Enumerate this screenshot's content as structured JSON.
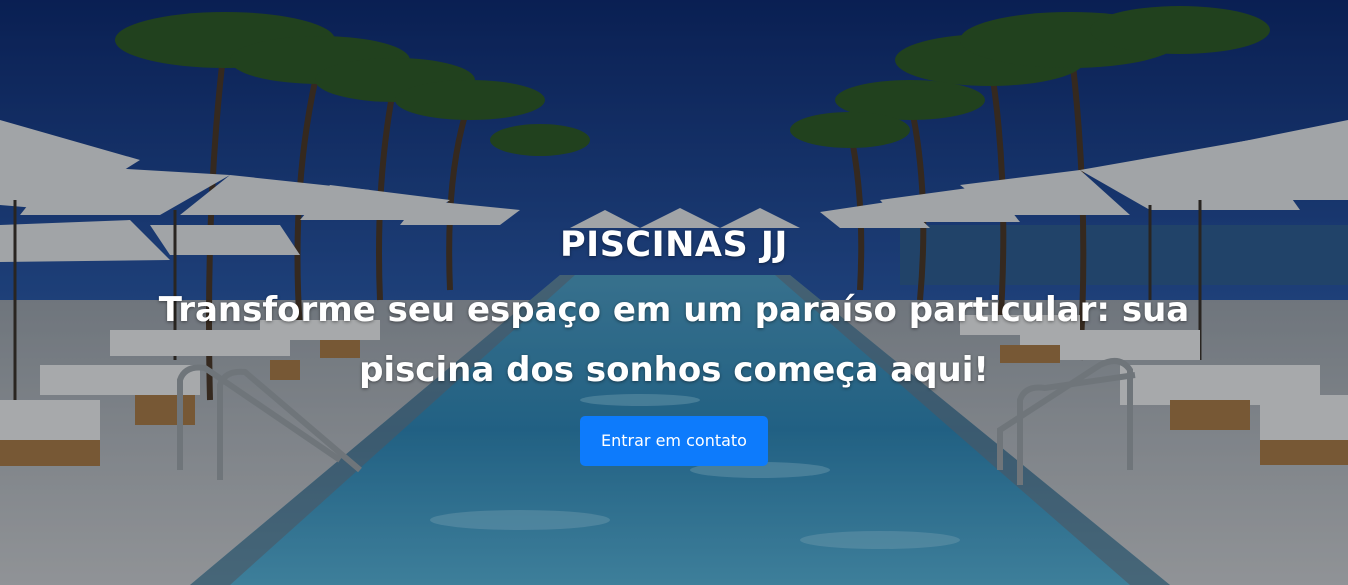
{
  "hero": {
    "brand": "PISCINAS JJ",
    "tagline": "Transforme seu espaço em um paraíso particular: sua piscina dos sonhos começa aqui!",
    "cta_label": "Entrar em contato",
    "accent_color": "#0d7bfc",
    "background_image": "pool-resort-photo"
  }
}
